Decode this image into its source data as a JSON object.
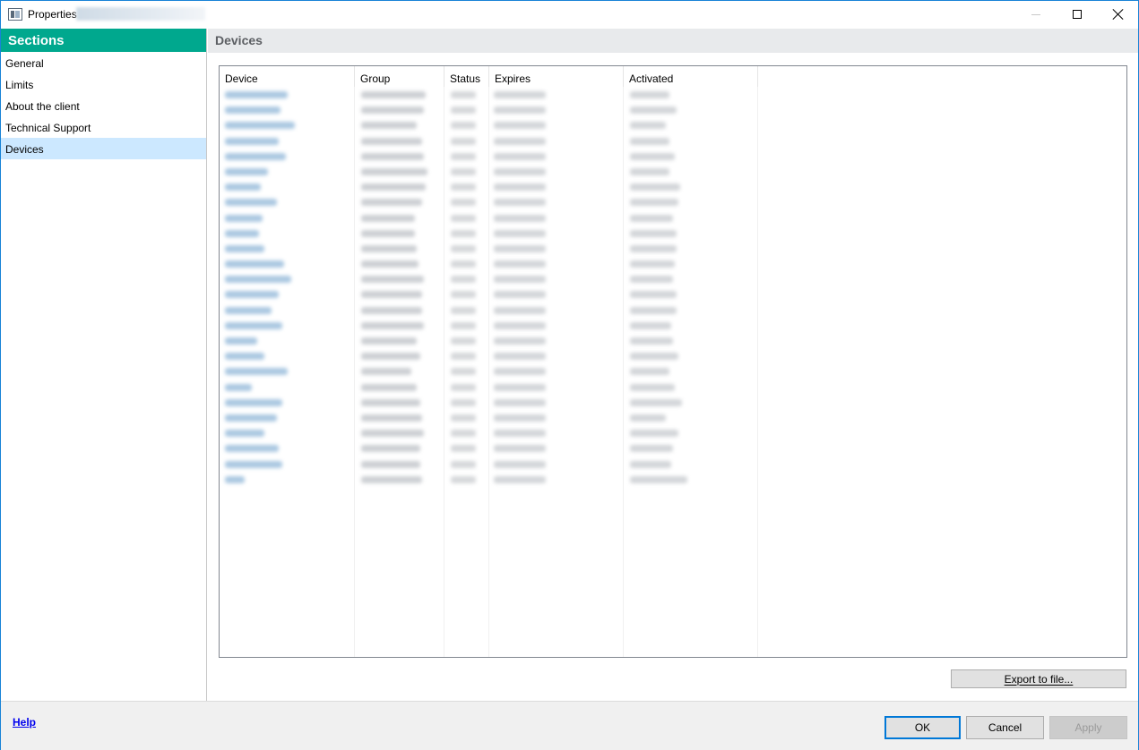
{
  "window": {
    "title": "Properties",
    "controls": {
      "minimize": "minimize-icon",
      "maximize": "maximize-icon",
      "close": "close-icon"
    }
  },
  "sidebar": {
    "header": "Sections",
    "items": [
      {
        "label": "General"
      },
      {
        "label": "Limits"
      },
      {
        "label": "About the client"
      },
      {
        "label": "Technical Support"
      },
      {
        "label": "Devices",
        "selected": true
      }
    ]
  },
  "main": {
    "title": "Devices",
    "table": {
      "columns": [
        "Device",
        "Group",
        "Status",
        "Expires",
        "Activated"
      ],
      "redacted_rows": 26
    },
    "export_label": "Export to file..."
  },
  "footer": {
    "help_label": "Help",
    "ok_label": "OK",
    "cancel_label": "Cancel",
    "apply_label": "Apply"
  },
  "colors": {
    "accent": "#00a88e",
    "selection": "#cce8ff",
    "header_bg": "#e8eaec",
    "window_border": "#1883d7",
    "primary_button_border": "#0078d7"
  }
}
